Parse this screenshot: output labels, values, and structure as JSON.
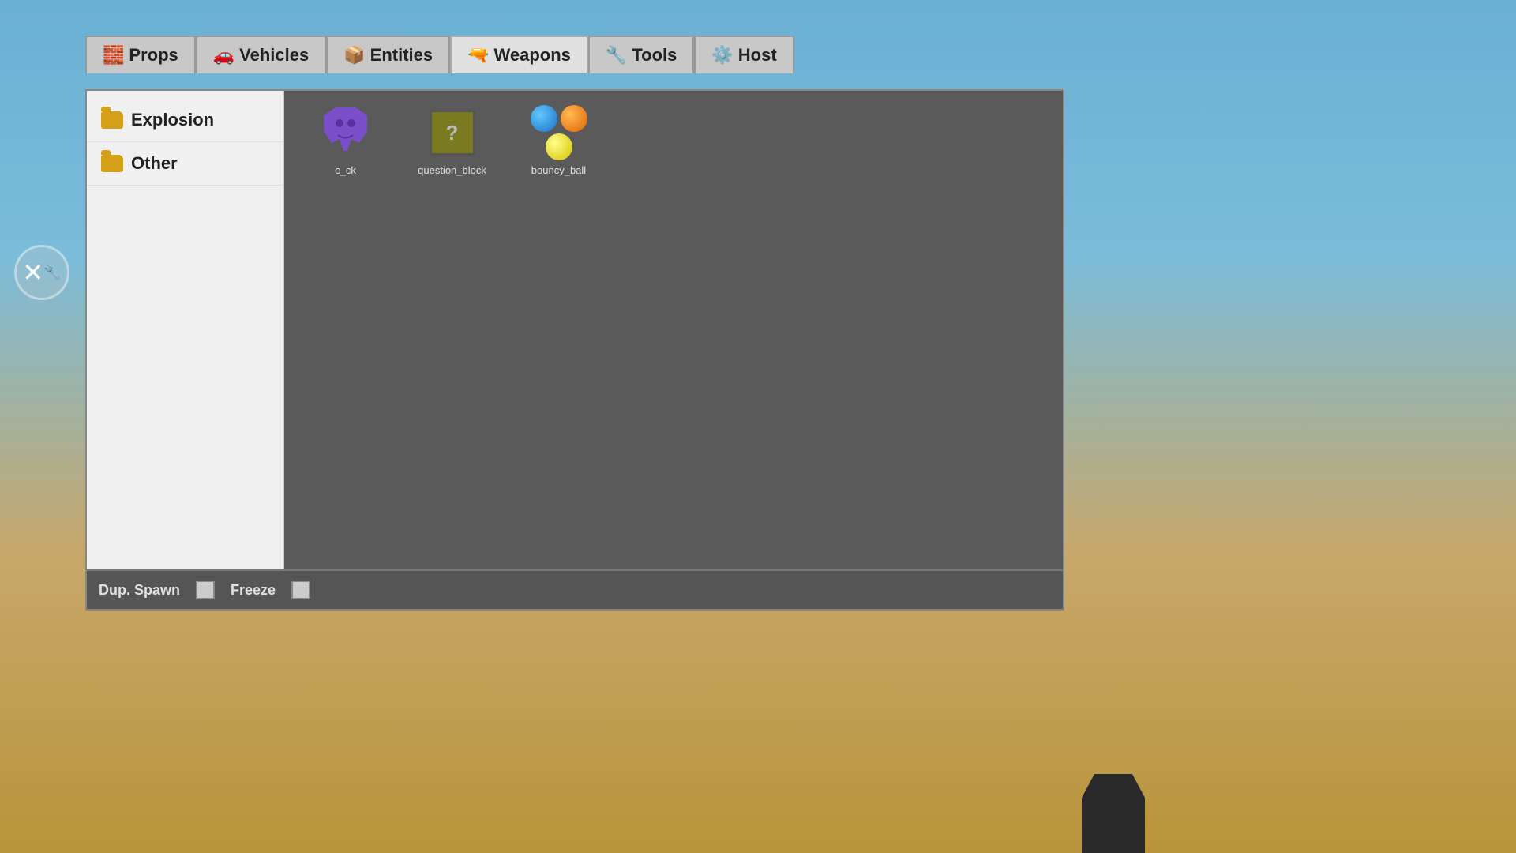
{
  "background": {
    "sky_color": "#6ab0d4",
    "ground_color": "#b8943a"
  },
  "tabs": [
    {
      "id": "props",
      "label": "Props",
      "icon": "🧱",
      "active": false
    },
    {
      "id": "vehicles",
      "label": "Vehicles",
      "icon": "🚗",
      "active": false
    },
    {
      "id": "entities",
      "label": "Entities",
      "icon": "📦",
      "active": false
    },
    {
      "id": "weapons",
      "label": "Weapons",
      "icon": "🔫",
      "active": true
    },
    {
      "id": "tools",
      "label": "Tools",
      "icon": "🔧",
      "active": false
    },
    {
      "id": "host",
      "label": "Host",
      "icon": "⚙️",
      "active": false
    }
  ],
  "sidebar": {
    "categories": [
      {
        "id": "explosion",
        "label": "Explosion"
      },
      {
        "id": "other",
        "label": "Other"
      }
    ]
  },
  "items": [
    {
      "id": "c_ck",
      "label": "c_ck",
      "type": "c_ck"
    },
    {
      "id": "question_block",
      "label": "question_block",
      "type": "question_block"
    },
    {
      "id": "bouncy_ball",
      "label": "bouncy_ball",
      "type": "bouncy_ball"
    }
  ],
  "bottom_bar": {
    "dup_spawn_label": "Dup. Spawn",
    "freeze_label": "Freeze"
  }
}
